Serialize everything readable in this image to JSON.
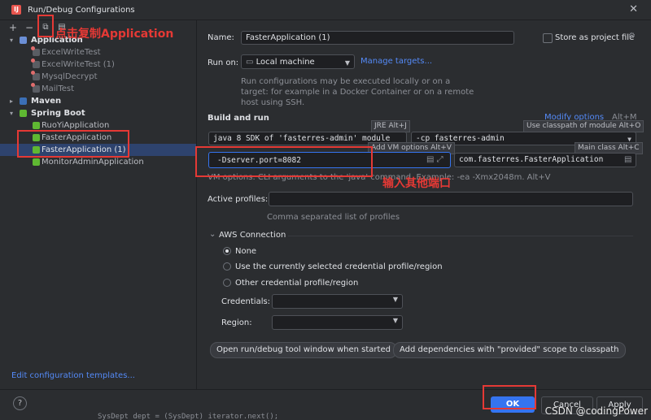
{
  "window": {
    "title": "Run/Debug Configurations"
  },
  "toolbar": {
    "add": "+",
    "remove": "−",
    "copy_icon": "copy-icon",
    "save_icon": "save-icon"
  },
  "tree": {
    "application_group": "Application",
    "junit_items": [
      "ExcelWriteTest",
      "ExcelWriteTest (1)",
      "MysqlDecrypt",
      "MailTest"
    ],
    "maven": "Maven",
    "spring_boot": "Spring Boot",
    "spring_items": [
      "RuoYiApplication",
      "FasterApplication",
      "FasterApplication (1)",
      "MonitorAdminApplication"
    ]
  },
  "left_footer": {
    "edit_templates": "Edit configuration templates..."
  },
  "form": {
    "name_label": "Name:",
    "name_value": "FasterApplication (1)",
    "store_label": "Store as project file",
    "run_on_label": "Run on:",
    "run_on_value": "Local machine",
    "manage_targets": "Manage targets...",
    "run_on_help": "Run configurations may be executed locally or on a target: for example in a Docker Container or on a remote host using SSH.",
    "build_and_run": "Build and run",
    "modify_options": "Modify options",
    "modify_shortcut": "Alt+M",
    "jre_hint": "JRE Alt+J",
    "use_classpath_hint": "Use classpath of module Alt+O",
    "java_value": "java 8 SDK of 'fasterres-admin' module",
    "cp_value": "-cp fasterres-admin",
    "add_vm_hint": "Add VM options Alt+V",
    "main_class_hint": "Main class Alt+C",
    "vm_value": "-Dserver.port=8082",
    "main_class_value": "com.fasterres.FasterApplication",
    "vm_help": "VM options. CLI arguments to the 'java' command. Example: -ea -Xmx2048m. Alt+V",
    "active_profiles_label": "Active profiles:",
    "active_profiles_help": "Comma separated list of profiles",
    "aws_title": "AWS Connection",
    "aws_none": "None",
    "aws_current": "Use the currently selected credential profile/region",
    "aws_other": "Other credential profile/region",
    "credentials_label": "Credentials:",
    "region_label": "Region:",
    "chip_open": "Open run/debug tool window when started",
    "chip_provided": "Add dependencies with \"provided\" scope to classpath"
  },
  "buttons": {
    "help": "?",
    "ok": "OK",
    "cancel": "Cancel",
    "apply": "Apply"
  },
  "background_code": "SysDept dept = (SysDept) iterator.next();",
  "annotations": {
    "copy_note": "点击复制Application",
    "port_note": "输入其他端口"
  },
  "watermark": "CSDN @codingPower"
}
